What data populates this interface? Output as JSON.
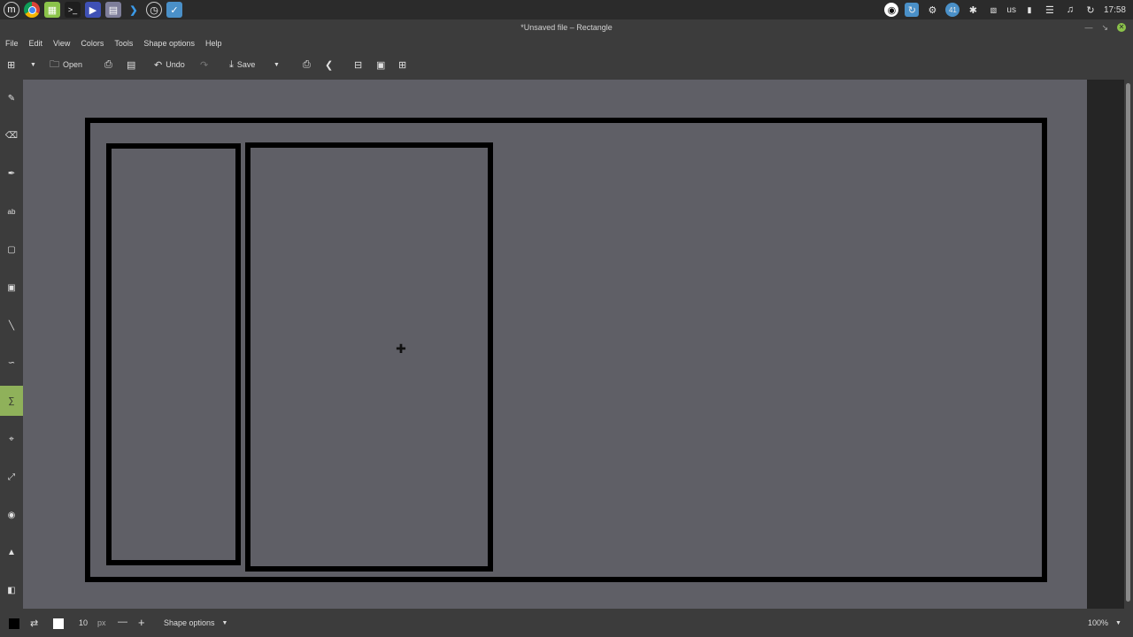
{
  "system_panel": {
    "launchers": [
      "menu-icon",
      "chrome-icon",
      "folder-icon",
      "terminal-icon",
      "media-icon",
      "notes-icon",
      "vscode-icon",
      "clock-app-icon",
      "drawing-app-icon"
    ],
    "tray": {
      "badge_count": "41",
      "keyboard_layout": "us",
      "time": "17:58"
    }
  },
  "window": {
    "title": "*Unsaved file – Rectangle"
  },
  "menubar": {
    "items": [
      "File",
      "Edit",
      "View",
      "Colors",
      "Tools",
      "Shape options",
      "Help"
    ]
  },
  "toolbar": {
    "open_label": "Open",
    "undo_label": "Undo",
    "save_label": "Save"
  },
  "tools": [
    "pencil",
    "eraser",
    "highlighter",
    "text",
    "rectangle",
    "filled-rectangle",
    "line",
    "curve",
    "shape",
    "crop",
    "scale",
    "filters",
    "skew",
    "select"
  ],
  "active_tool": "shape",
  "bottombar": {
    "size_value": "10",
    "size_unit": "px",
    "shape_options_label": "Shape options",
    "zoom_label": "100%"
  },
  "colors": {
    "primary": "#000000",
    "secondary": "#ffffff",
    "canvas": "#5f5f66",
    "accent": "#8fb15a"
  }
}
